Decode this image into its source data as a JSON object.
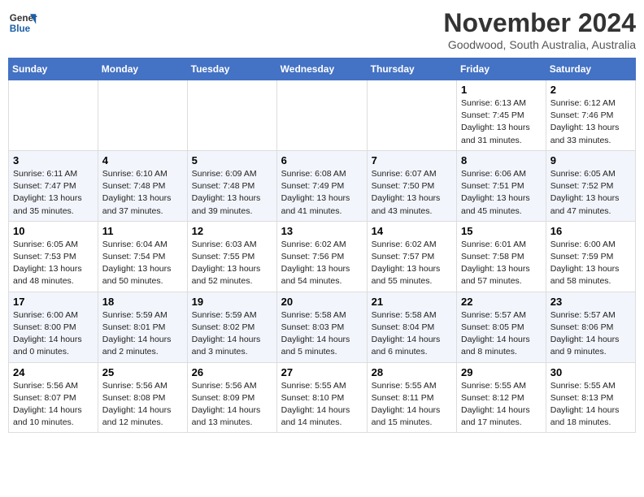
{
  "header": {
    "logo_line1": "General",
    "logo_line2": "Blue",
    "month": "November 2024",
    "location": "Goodwood, South Australia, Australia"
  },
  "days_of_week": [
    "Sunday",
    "Monday",
    "Tuesday",
    "Wednesday",
    "Thursday",
    "Friday",
    "Saturday"
  ],
  "weeks": [
    [
      {
        "day": "",
        "info": ""
      },
      {
        "day": "",
        "info": ""
      },
      {
        "day": "",
        "info": ""
      },
      {
        "day": "",
        "info": ""
      },
      {
        "day": "",
        "info": ""
      },
      {
        "day": "1",
        "info": "Sunrise: 6:13 AM\nSunset: 7:45 PM\nDaylight: 13 hours\nand 31 minutes."
      },
      {
        "day": "2",
        "info": "Sunrise: 6:12 AM\nSunset: 7:46 PM\nDaylight: 13 hours\nand 33 minutes."
      }
    ],
    [
      {
        "day": "3",
        "info": "Sunrise: 6:11 AM\nSunset: 7:47 PM\nDaylight: 13 hours\nand 35 minutes."
      },
      {
        "day": "4",
        "info": "Sunrise: 6:10 AM\nSunset: 7:48 PM\nDaylight: 13 hours\nand 37 minutes."
      },
      {
        "day": "5",
        "info": "Sunrise: 6:09 AM\nSunset: 7:48 PM\nDaylight: 13 hours\nand 39 minutes."
      },
      {
        "day": "6",
        "info": "Sunrise: 6:08 AM\nSunset: 7:49 PM\nDaylight: 13 hours\nand 41 minutes."
      },
      {
        "day": "7",
        "info": "Sunrise: 6:07 AM\nSunset: 7:50 PM\nDaylight: 13 hours\nand 43 minutes."
      },
      {
        "day": "8",
        "info": "Sunrise: 6:06 AM\nSunset: 7:51 PM\nDaylight: 13 hours\nand 45 minutes."
      },
      {
        "day": "9",
        "info": "Sunrise: 6:05 AM\nSunset: 7:52 PM\nDaylight: 13 hours\nand 47 minutes."
      }
    ],
    [
      {
        "day": "10",
        "info": "Sunrise: 6:05 AM\nSunset: 7:53 PM\nDaylight: 13 hours\nand 48 minutes."
      },
      {
        "day": "11",
        "info": "Sunrise: 6:04 AM\nSunset: 7:54 PM\nDaylight: 13 hours\nand 50 minutes."
      },
      {
        "day": "12",
        "info": "Sunrise: 6:03 AM\nSunset: 7:55 PM\nDaylight: 13 hours\nand 52 minutes."
      },
      {
        "day": "13",
        "info": "Sunrise: 6:02 AM\nSunset: 7:56 PM\nDaylight: 13 hours\nand 54 minutes."
      },
      {
        "day": "14",
        "info": "Sunrise: 6:02 AM\nSunset: 7:57 PM\nDaylight: 13 hours\nand 55 minutes."
      },
      {
        "day": "15",
        "info": "Sunrise: 6:01 AM\nSunset: 7:58 PM\nDaylight: 13 hours\nand 57 minutes."
      },
      {
        "day": "16",
        "info": "Sunrise: 6:00 AM\nSunset: 7:59 PM\nDaylight: 13 hours\nand 58 minutes."
      }
    ],
    [
      {
        "day": "17",
        "info": "Sunrise: 6:00 AM\nSunset: 8:00 PM\nDaylight: 14 hours\nand 0 minutes."
      },
      {
        "day": "18",
        "info": "Sunrise: 5:59 AM\nSunset: 8:01 PM\nDaylight: 14 hours\nand 2 minutes."
      },
      {
        "day": "19",
        "info": "Sunrise: 5:59 AM\nSunset: 8:02 PM\nDaylight: 14 hours\nand 3 minutes."
      },
      {
        "day": "20",
        "info": "Sunrise: 5:58 AM\nSunset: 8:03 PM\nDaylight: 14 hours\nand 5 minutes."
      },
      {
        "day": "21",
        "info": "Sunrise: 5:58 AM\nSunset: 8:04 PM\nDaylight: 14 hours\nand 6 minutes."
      },
      {
        "day": "22",
        "info": "Sunrise: 5:57 AM\nSunset: 8:05 PM\nDaylight: 14 hours\nand 8 minutes."
      },
      {
        "day": "23",
        "info": "Sunrise: 5:57 AM\nSunset: 8:06 PM\nDaylight: 14 hours\nand 9 minutes."
      }
    ],
    [
      {
        "day": "24",
        "info": "Sunrise: 5:56 AM\nSunset: 8:07 PM\nDaylight: 14 hours\nand 10 minutes."
      },
      {
        "day": "25",
        "info": "Sunrise: 5:56 AM\nSunset: 8:08 PM\nDaylight: 14 hours\nand 12 minutes."
      },
      {
        "day": "26",
        "info": "Sunrise: 5:56 AM\nSunset: 8:09 PM\nDaylight: 14 hours\nand 13 minutes."
      },
      {
        "day": "27",
        "info": "Sunrise: 5:55 AM\nSunset: 8:10 PM\nDaylight: 14 hours\nand 14 minutes."
      },
      {
        "day": "28",
        "info": "Sunrise: 5:55 AM\nSunset: 8:11 PM\nDaylight: 14 hours\nand 15 minutes."
      },
      {
        "day": "29",
        "info": "Sunrise: 5:55 AM\nSunset: 8:12 PM\nDaylight: 14 hours\nand 17 minutes."
      },
      {
        "day": "30",
        "info": "Sunrise: 5:55 AM\nSunset: 8:13 PM\nDaylight: 14 hours\nand 18 minutes."
      }
    ]
  ]
}
